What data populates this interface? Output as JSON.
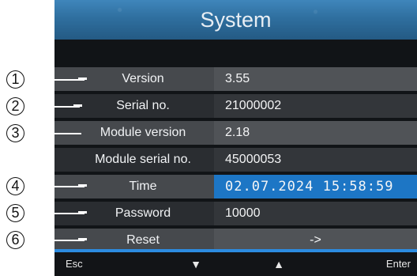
{
  "screen": {
    "title": "System",
    "rows": [
      {
        "label": "Version",
        "value": "3.55"
      },
      {
        "label": "Serial no.",
        "value": "21000002"
      },
      {
        "label": "Module version",
        "value": "2.18"
      },
      {
        "label": "Module serial no.",
        "value": "45000053"
      },
      {
        "label": "Time",
        "value": "02.07.2024 15:58:59",
        "selected": true
      },
      {
        "label": "Password",
        "value": "10000"
      },
      {
        "label": "Reset",
        "value": "->"
      }
    ],
    "footer": {
      "esc": "Esc",
      "down": "▼",
      "up": "▲",
      "enter": "Enter"
    }
  },
  "callouts": [
    "1",
    "2",
    "3",
    "4",
    "5",
    "6"
  ],
  "colors": {
    "title_bar": "#2f6f9f",
    "selected_row": "#1d76c5",
    "accent_line": "#2c8be0",
    "dark_row": "#2a2d31",
    "light_row": "#46494d"
  }
}
